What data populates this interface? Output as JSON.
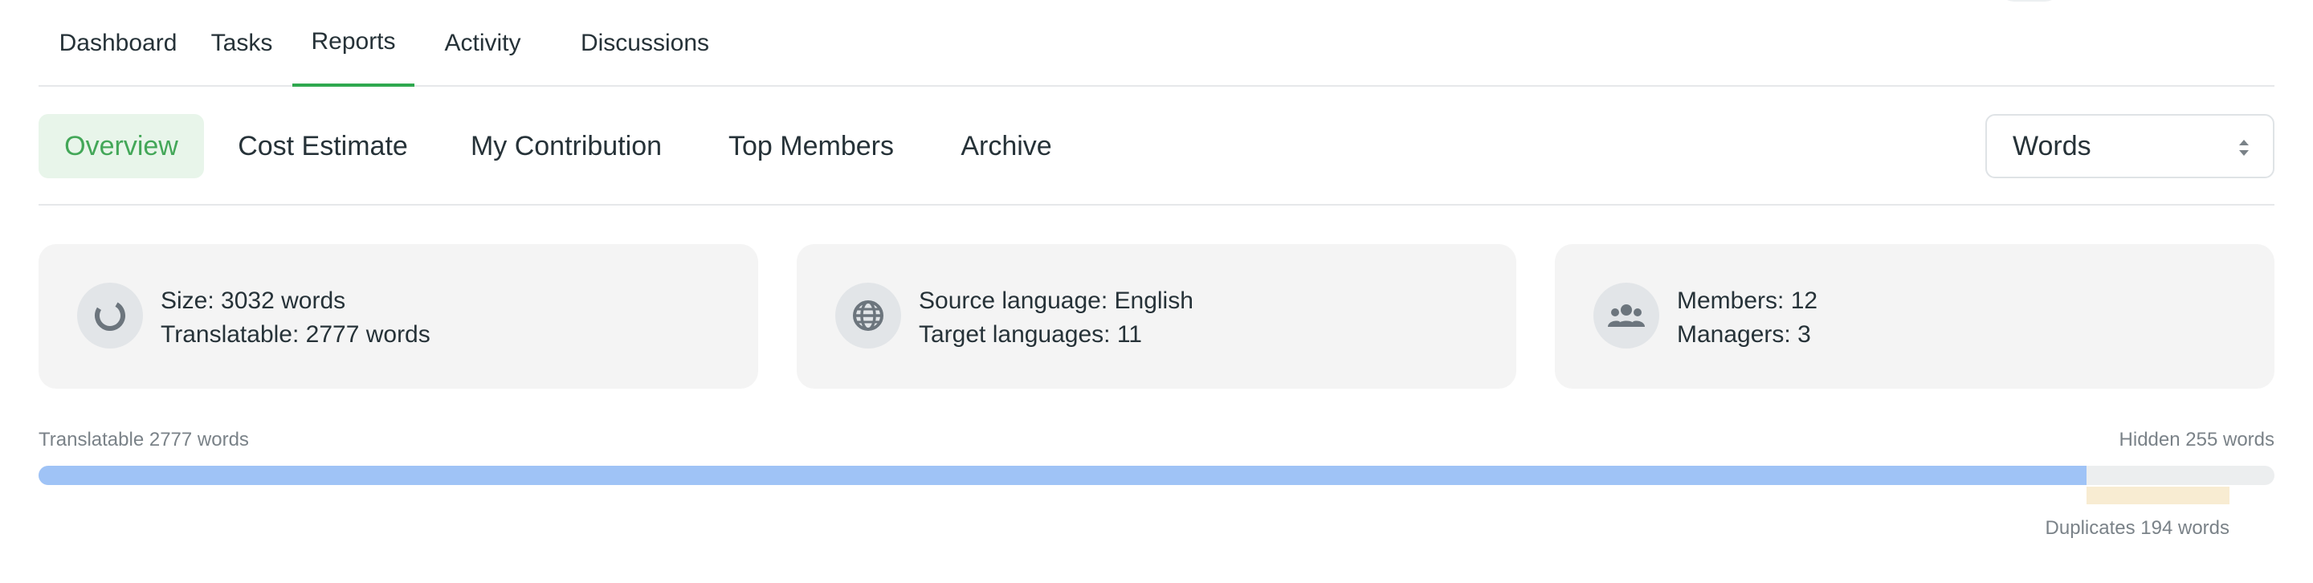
{
  "top_tabs": [
    {
      "label": "Dashboard"
    },
    {
      "label": "Tasks"
    },
    {
      "label": "Reports",
      "active": true
    },
    {
      "label": "Activity"
    },
    {
      "label": "Discussions"
    }
  ],
  "sub_nav": {
    "tabs": [
      {
        "label": "Overview",
        "active": true
      },
      {
        "label": "Cost Estimate"
      },
      {
        "label": "My Contribution"
      },
      {
        "label": "Top Members"
      },
      {
        "label": "Archive"
      }
    ],
    "unit_select": {
      "value": "Words"
    }
  },
  "cards": [
    {
      "icon": "pie-chart-icon",
      "line1": "Size: 3032 words",
      "line2": "Translatable: 2777 words"
    },
    {
      "icon": "globe-icon",
      "line1": "Source language: English",
      "line2": "Target languages: 11"
    },
    {
      "icon": "users-icon",
      "line1": "Members: 12",
      "line2": "Managers: 3"
    }
  ],
  "progress": {
    "translatable_label": "Translatable 2777 words",
    "hidden_label": "Hidden 255 words",
    "duplicates_label": "Duplicates 194 words",
    "total_words": 3032,
    "translatable_words": 2777,
    "hidden_words": 255,
    "duplicate_words": 194
  },
  "colors": {
    "accent_green": "#2fa84f",
    "active_tab_bg": "#e8f5ea",
    "progress_blue": "#9fc3f6",
    "duplicates_tint": "#f8ecd2"
  }
}
